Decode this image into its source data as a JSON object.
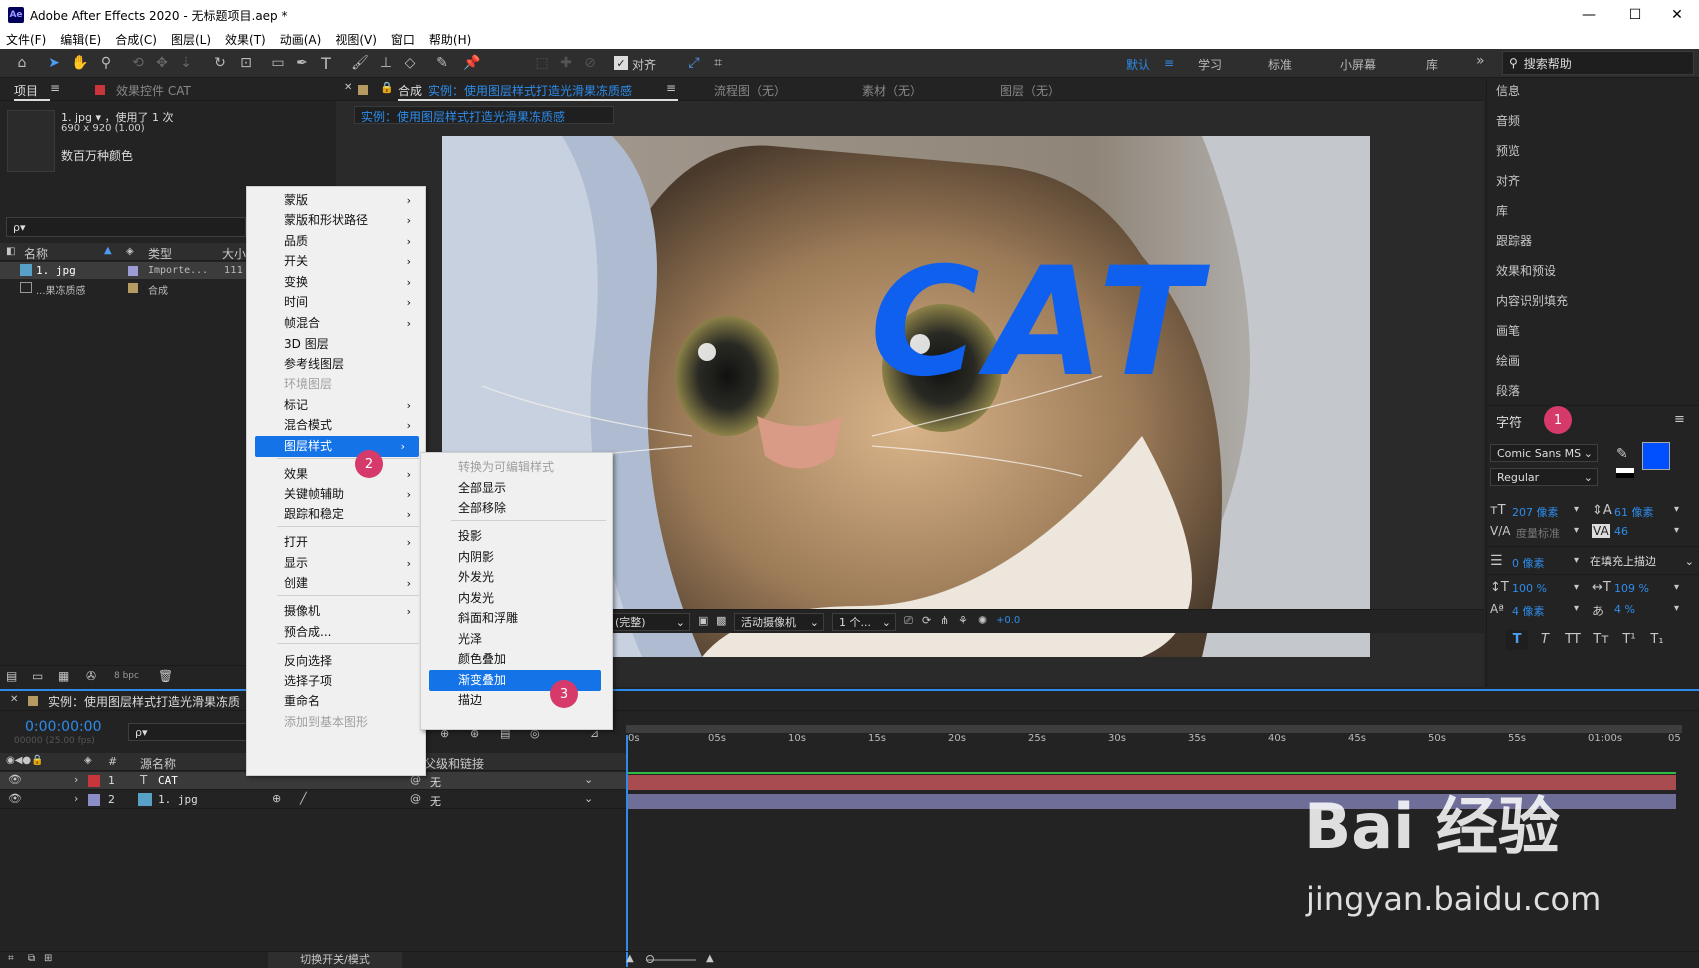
{
  "app": {
    "logo": "Ae",
    "title": "Adobe After Effects 2020 - 无标题项目.aep *",
    "window_buttons": [
      "—",
      "☐",
      "✕"
    ]
  },
  "menu": [
    "文件(F)",
    "编辑(E)",
    "合成(C)",
    "图层(L)",
    "效果(T)",
    "动画(A)",
    "视图(V)",
    "窗口",
    "帮助(H)"
  ],
  "toolbar": {
    "snap_label": "对齐",
    "workspaces": [
      "默认",
      "学习",
      "标准",
      "小屏幕",
      "库"
    ],
    "more": "»",
    "search_help": "搜索帮助"
  },
  "project_panel": {
    "tab_project": "项目",
    "tab_effects": "效果控件 CAT",
    "item_name": "1. jpg ▾ ，使用了 1 次",
    "item_size": "690 x 920 (1.00)",
    "item_colors": "数百万种颜色",
    "search_placeholder": "ρ▾",
    "columns": [
      "名称",
      "类型",
      "大小"
    ],
    "rows": [
      {
        "name": "1. jpg",
        "type": "Importe...",
        "size": "111"
      },
      {
        "name": "...果冻质感",
        "type": "合成",
        "size": ""
      }
    ],
    "bpc": "8 bpc"
  },
  "comp_panel": {
    "tab_label": "合成",
    "comp_name": "实例：使用图层样式打造光滑果冻质感",
    "flowchart": "流程图（无）",
    "footage": "素材（无）",
    "layer": "图层（无）",
    "breadcrumb": "实例：使用图层样式打造光滑果冻质感",
    "text_content": "CAT",
    "text_color": "#1060f0",
    "resolution": "(完整)",
    "camera": "活动摄像机",
    "views": "1 个...",
    "exposure": "+0.0"
  },
  "right_panels": [
    "信息",
    "音频",
    "预览",
    "对齐",
    "库",
    "跟踪器",
    "效果和预设",
    "内容识别填充",
    "画笔",
    "绘画",
    "段落"
  ],
  "character": {
    "title": "字符",
    "font": "Comic Sans MS",
    "style": "Regular",
    "font_size": "207 像素",
    "leading": "61 像素",
    "kerning": "度量标准",
    "tracking": "46",
    "stroke_width": "0 像素",
    "stroke_mode": "在填充上描边",
    "vscale": "100 %",
    "hscale": "109 %",
    "baseline": "4 像素",
    "tsume": "4 %",
    "fill_color": "#0050ff",
    "type_buttons": [
      "T",
      "T",
      "TT",
      "Tт",
      "T¹",
      "T₁"
    ]
  },
  "context_menu": {
    "items": [
      {
        "label": "蒙版",
        "sub": true
      },
      {
        "label": "蒙版和形状路径",
        "sub": true
      },
      {
        "label": "品质",
        "sub": true
      },
      {
        "label": "开关",
        "sub": true
      },
      {
        "label": "变换",
        "sub": true
      },
      {
        "label": "时间",
        "sub": true
      },
      {
        "label": "帧混合",
        "sub": true
      },
      {
        "label": "3D 图层",
        "sub": false
      },
      {
        "label": "参考线图层",
        "sub": false
      },
      {
        "label": "环境图层",
        "sub": false,
        "disabled": true
      },
      {
        "label": "标记",
        "sub": true
      },
      {
        "label": "混合模式",
        "sub": true
      },
      {
        "label": "图层样式",
        "sub": true,
        "highlighted": true
      },
      {
        "label": "效果",
        "sub": true
      },
      {
        "label": "关键帧辅助",
        "sub": true
      },
      {
        "label": "跟踪和稳定",
        "sub": true
      },
      {
        "label": "打开",
        "sub": true
      },
      {
        "label": "显示",
        "sub": true
      },
      {
        "label": "创建",
        "sub": true
      },
      {
        "label": "摄像机",
        "sub": true
      },
      {
        "label": "预合成...",
        "sub": false
      },
      {
        "label": "反向选择",
        "sub": false
      },
      {
        "label": "选择子项",
        "sub": false
      },
      {
        "label": "重命名",
        "sub": false
      },
      {
        "label": "添加到基本图形",
        "sub": false,
        "disabled": true
      }
    ]
  },
  "submenu": {
    "items": [
      {
        "label": "转换为可编辑样式",
        "disabled": true
      },
      {
        "label": "全部显示"
      },
      {
        "label": "全部移除"
      },
      {
        "label": "投影"
      },
      {
        "label": "内阴影"
      },
      {
        "label": "外发光"
      },
      {
        "label": "内发光"
      },
      {
        "label": "斜面和浮雕"
      },
      {
        "label": "光泽"
      },
      {
        "label": "颜色叠加"
      },
      {
        "label": "渐变叠加",
        "highlighted": true
      },
      {
        "label": "描边"
      }
    ]
  },
  "badges": [
    "1",
    "2",
    "3"
  ],
  "timeline": {
    "tab_label": "实例：使用图层样式打造光滑果冻质",
    "timecode": "0:00:00:00",
    "timecode_sub": "00000 (25.00 fps)",
    "search_placeholder": "ρ▾",
    "col_number": "#",
    "col_source": "源名称",
    "col_parent": "父级和链接",
    "layers": [
      {
        "num": "1",
        "name": "CAT",
        "parent": "无",
        "color": "#c8363b",
        "bar": "#a84c4f"
      },
      {
        "num": "2",
        "name": "1. jpg",
        "parent": "无",
        "color": "#8c8cc8",
        "bar": "#6e6e99"
      }
    ],
    "ruler": [
      "0s",
      "05s",
      "10s",
      "15s",
      "20s",
      "25s",
      "30s",
      "35s",
      "40s",
      "45s",
      "50s",
      "55s",
      "01:00s",
      "05"
    ],
    "toggle_label": "切换开关/模式"
  },
  "watermark": {
    "brand": "Bai 经验",
    "url": "jingyan.baidu.com"
  }
}
